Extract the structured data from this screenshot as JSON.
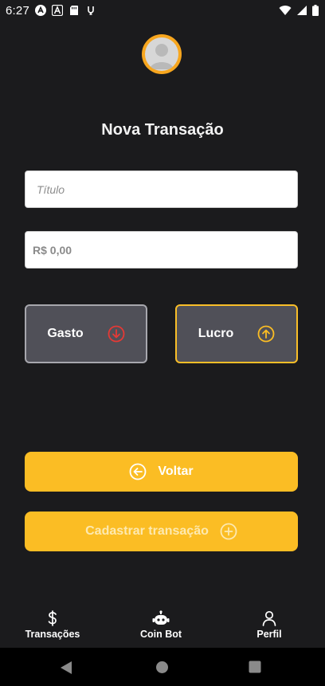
{
  "status_bar": {
    "time": "6:27",
    "left_icons": [
      "a-badge-icon",
      "a-letter-icon",
      "sd-card-icon",
      "link-icon"
    ],
    "right_icons": [
      "wifi-icon",
      "signal-icon",
      "battery-icon"
    ]
  },
  "header": {
    "avatar_icon": "user-avatar-icon",
    "title": "Nova Transação"
  },
  "form": {
    "title_placeholder": "Título",
    "amount_placeholder": "R$ 0,00",
    "expense_label": "Gasto",
    "income_label": "Lucro"
  },
  "actions": {
    "back_label": "Voltar",
    "register_label": "Cadastrar transação"
  },
  "bottom_nav": {
    "items": [
      {
        "label": "Transações",
        "icon": "dollar-icon"
      },
      {
        "label": "Coin Bot",
        "icon": "robot-icon"
      },
      {
        "label": "Perfil",
        "icon": "person-icon"
      }
    ]
  },
  "colors": {
    "background": "#1b1b1d",
    "accent": "#fbbd24",
    "avatar_ring": "#f7a61e",
    "expense_red": "#e53935",
    "card": "#505058"
  }
}
